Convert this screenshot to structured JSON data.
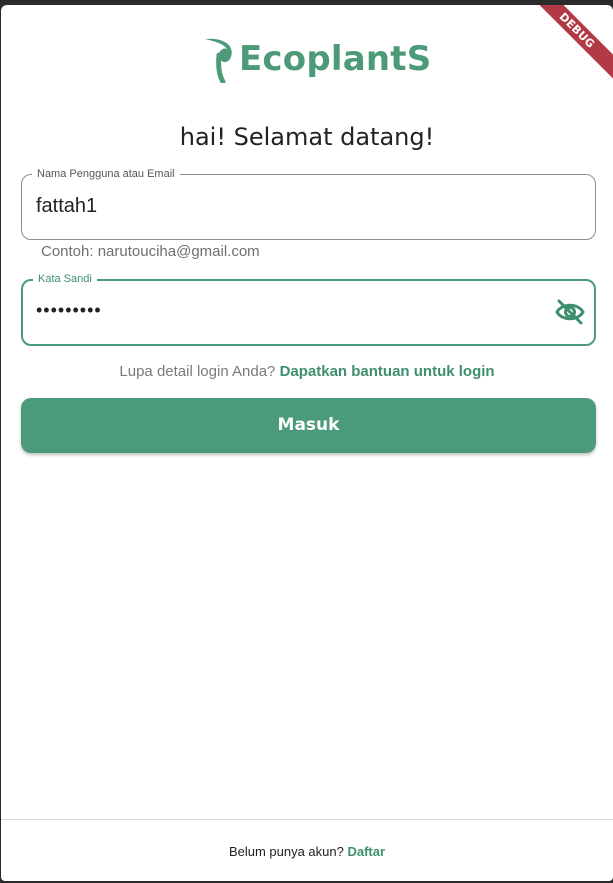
{
  "debug_banner": "DEBUG",
  "logo": {
    "text": "EcoplantS",
    "icon": "leaf-icon",
    "color": "#4d9a78"
  },
  "welcome_title": "hai! Selamat datang!",
  "username_field": {
    "label": "Nama Pengguna atau Email",
    "value": "fattah1",
    "helper": "Contoh: narutouciha@gmail.com"
  },
  "password_field": {
    "label": "Kata Sandi",
    "value": "•••••••••",
    "toggle_icon": "eye-off-icon"
  },
  "help": {
    "prompt": "Lupa detail login Anda?",
    "link": "Dapatkan bantuan untuk login"
  },
  "login_button": "Masuk",
  "footer": {
    "prompt": "Belum punya akun?",
    "link": "Daftar"
  },
  "colors": {
    "accent": "#4b9a7b",
    "debug": "#b13a46"
  }
}
